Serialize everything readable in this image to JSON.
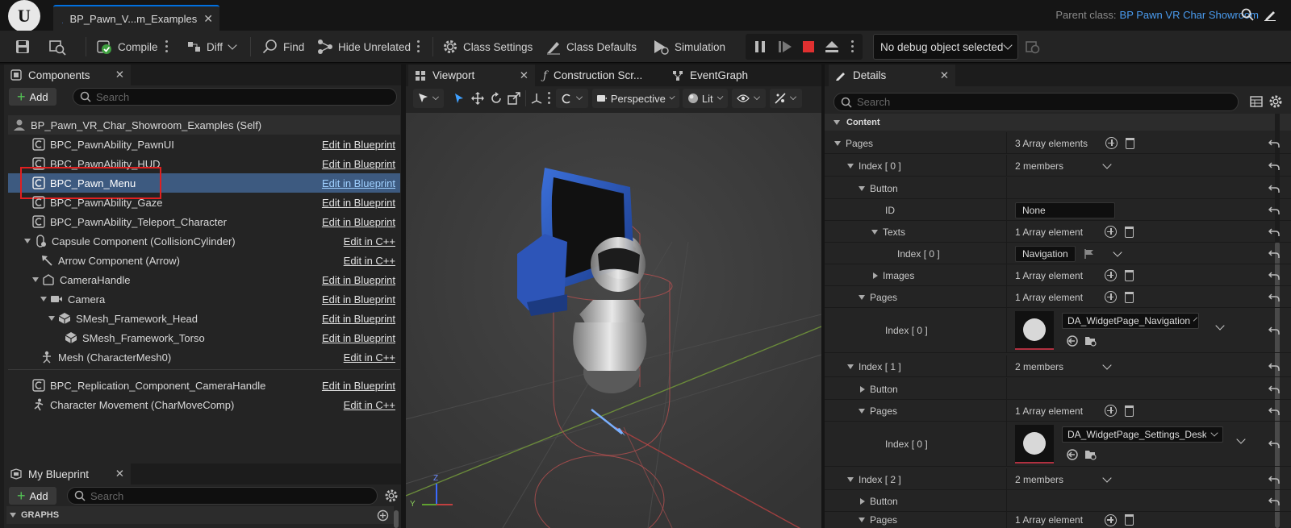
{
  "window": {
    "doc_tab_title": "BP_Pawn_V...m_Examples",
    "parent_class_label": "Parent class:",
    "parent_class_value": "BP Pawn VR Char Showroom"
  },
  "toolbar": {
    "compile": "Compile",
    "diff": "Diff",
    "find": "Find",
    "hide_unrelated": "Hide Unrelated",
    "class_settings": "Class Settings",
    "class_defaults": "Class Defaults",
    "simulation": "Simulation",
    "debug_object": "No debug object selected"
  },
  "components_panel": {
    "tab": "Components",
    "add": "Add",
    "search_placeholder": "Search",
    "items": [
      {
        "label": "BP_Pawn_VR_Char_Showroom_Examples (Self)",
        "link": ""
      },
      {
        "label": "BPC_PawnAbility_PawnUI",
        "link": "Edit in Blueprint"
      },
      {
        "label": "BPC_PawnAbility_HUD",
        "link": "Edit in Blueprint"
      },
      {
        "label": "BPC_Pawn_Menu",
        "link": "Edit in Blueprint"
      },
      {
        "label": "BPC_PawnAbility_Gaze",
        "link": "Edit in Blueprint"
      },
      {
        "label": "BPC_PawnAbility_Teleport_Character",
        "link": "Edit in Blueprint"
      },
      {
        "label": "Capsule Component (CollisionCylinder)",
        "link": "Edit in C++"
      },
      {
        "label": "Arrow Component (Arrow)",
        "link": "Edit in C++"
      },
      {
        "label": "CameraHandle",
        "link": "Edit in Blueprint"
      },
      {
        "label": "Camera",
        "link": "Edit in Blueprint"
      },
      {
        "label": "SMesh_Framework_Head",
        "link": "Edit in Blueprint"
      },
      {
        "label": "SMesh_Framework_Torso",
        "link": "Edit in Blueprint"
      },
      {
        "label": "Mesh (CharacterMesh0)",
        "link": "Edit in C++"
      },
      {
        "label": "BPC_Replication_Component_CameraHandle",
        "link": "Edit in Blueprint"
      },
      {
        "label": "Character Movement (CharMoveComp)",
        "link": "Edit in C++"
      }
    ]
  },
  "my_blueprint": {
    "tab": "My Blueprint",
    "add": "Add",
    "search_placeholder": "Search",
    "graphs_header": "GRAPHS"
  },
  "center_tabs": {
    "viewport": "Viewport",
    "construction": "Construction Scr...",
    "event_graph": "EventGraph"
  },
  "viewport_toolbar": {
    "perspective": "Perspective",
    "lit": "Lit"
  },
  "viewport_axis": {
    "z": "Z",
    "y": "Y"
  },
  "details": {
    "tab": "Details",
    "search_placeholder": "Search",
    "section": "Content",
    "rows": [
      {
        "name": "Pages",
        "value": "3 Array elements"
      },
      {
        "name": "Index [ 0 ]",
        "value": "2 members"
      },
      {
        "name": "Button",
        "value": ""
      },
      {
        "name": "ID",
        "value": "None"
      },
      {
        "name": "Texts",
        "value": "1 Array element"
      },
      {
        "name": "Index [ 0 ]",
        "value": "Navigation"
      },
      {
        "name": "Images",
        "value": "1 Array element"
      },
      {
        "name": "Pages",
        "value": "1 Array element"
      },
      {
        "name": "Index [ 0 ]",
        "value": "DA_WidgetPage_Navigation"
      },
      {
        "name": "Index [ 1 ]",
        "value": "2 members"
      },
      {
        "name": "Button",
        "value": ""
      },
      {
        "name": "Pages",
        "value": "1 Array element"
      },
      {
        "name": "Index [ 0 ]",
        "value": "DA_WidgetPage_Settings_Deskto"
      },
      {
        "name": "Index [ 2 ]",
        "value": "2 members"
      },
      {
        "name": "Button",
        "value": ""
      },
      {
        "name": "Pages",
        "value": "1 Array element"
      }
    ]
  },
  "colors": {
    "accent_blue": "#0070e0",
    "selection": "#3d5a80",
    "highlight_box": "#e02020",
    "link_blue": "#4a9cf0",
    "stop_red": "#e03030"
  }
}
